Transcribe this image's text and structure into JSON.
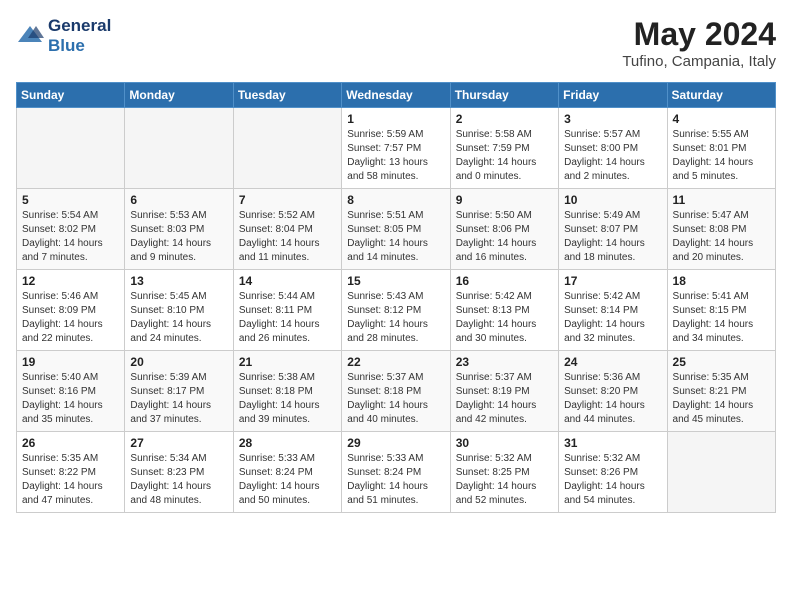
{
  "logo": {
    "line1": "General",
    "line2": "Blue"
  },
  "title": "May 2024",
  "location": "Tufino, Campania, Italy",
  "days_header": [
    "Sunday",
    "Monday",
    "Tuesday",
    "Wednesday",
    "Thursday",
    "Friday",
    "Saturday"
  ],
  "weeks": [
    [
      {
        "num": "",
        "info": ""
      },
      {
        "num": "",
        "info": ""
      },
      {
        "num": "",
        "info": ""
      },
      {
        "num": "1",
        "info": "Sunrise: 5:59 AM\nSunset: 7:57 PM\nDaylight: 13 hours\nand 58 minutes."
      },
      {
        "num": "2",
        "info": "Sunrise: 5:58 AM\nSunset: 7:59 PM\nDaylight: 14 hours\nand 0 minutes."
      },
      {
        "num": "3",
        "info": "Sunrise: 5:57 AM\nSunset: 8:00 PM\nDaylight: 14 hours\nand 2 minutes."
      },
      {
        "num": "4",
        "info": "Sunrise: 5:55 AM\nSunset: 8:01 PM\nDaylight: 14 hours\nand 5 minutes."
      }
    ],
    [
      {
        "num": "5",
        "info": "Sunrise: 5:54 AM\nSunset: 8:02 PM\nDaylight: 14 hours\nand 7 minutes."
      },
      {
        "num": "6",
        "info": "Sunrise: 5:53 AM\nSunset: 8:03 PM\nDaylight: 14 hours\nand 9 minutes."
      },
      {
        "num": "7",
        "info": "Sunrise: 5:52 AM\nSunset: 8:04 PM\nDaylight: 14 hours\nand 11 minutes."
      },
      {
        "num": "8",
        "info": "Sunrise: 5:51 AM\nSunset: 8:05 PM\nDaylight: 14 hours\nand 14 minutes."
      },
      {
        "num": "9",
        "info": "Sunrise: 5:50 AM\nSunset: 8:06 PM\nDaylight: 14 hours\nand 16 minutes."
      },
      {
        "num": "10",
        "info": "Sunrise: 5:49 AM\nSunset: 8:07 PM\nDaylight: 14 hours\nand 18 minutes."
      },
      {
        "num": "11",
        "info": "Sunrise: 5:47 AM\nSunset: 8:08 PM\nDaylight: 14 hours\nand 20 minutes."
      }
    ],
    [
      {
        "num": "12",
        "info": "Sunrise: 5:46 AM\nSunset: 8:09 PM\nDaylight: 14 hours\nand 22 minutes."
      },
      {
        "num": "13",
        "info": "Sunrise: 5:45 AM\nSunset: 8:10 PM\nDaylight: 14 hours\nand 24 minutes."
      },
      {
        "num": "14",
        "info": "Sunrise: 5:44 AM\nSunset: 8:11 PM\nDaylight: 14 hours\nand 26 minutes."
      },
      {
        "num": "15",
        "info": "Sunrise: 5:43 AM\nSunset: 8:12 PM\nDaylight: 14 hours\nand 28 minutes."
      },
      {
        "num": "16",
        "info": "Sunrise: 5:42 AM\nSunset: 8:13 PM\nDaylight: 14 hours\nand 30 minutes."
      },
      {
        "num": "17",
        "info": "Sunrise: 5:42 AM\nSunset: 8:14 PM\nDaylight: 14 hours\nand 32 minutes."
      },
      {
        "num": "18",
        "info": "Sunrise: 5:41 AM\nSunset: 8:15 PM\nDaylight: 14 hours\nand 34 minutes."
      }
    ],
    [
      {
        "num": "19",
        "info": "Sunrise: 5:40 AM\nSunset: 8:16 PM\nDaylight: 14 hours\nand 35 minutes."
      },
      {
        "num": "20",
        "info": "Sunrise: 5:39 AM\nSunset: 8:17 PM\nDaylight: 14 hours\nand 37 minutes."
      },
      {
        "num": "21",
        "info": "Sunrise: 5:38 AM\nSunset: 8:18 PM\nDaylight: 14 hours\nand 39 minutes."
      },
      {
        "num": "22",
        "info": "Sunrise: 5:37 AM\nSunset: 8:18 PM\nDaylight: 14 hours\nand 40 minutes."
      },
      {
        "num": "23",
        "info": "Sunrise: 5:37 AM\nSunset: 8:19 PM\nDaylight: 14 hours\nand 42 minutes."
      },
      {
        "num": "24",
        "info": "Sunrise: 5:36 AM\nSunset: 8:20 PM\nDaylight: 14 hours\nand 44 minutes."
      },
      {
        "num": "25",
        "info": "Sunrise: 5:35 AM\nSunset: 8:21 PM\nDaylight: 14 hours\nand 45 minutes."
      }
    ],
    [
      {
        "num": "26",
        "info": "Sunrise: 5:35 AM\nSunset: 8:22 PM\nDaylight: 14 hours\nand 47 minutes."
      },
      {
        "num": "27",
        "info": "Sunrise: 5:34 AM\nSunset: 8:23 PM\nDaylight: 14 hours\nand 48 minutes."
      },
      {
        "num": "28",
        "info": "Sunrise: 5:33 AM\nSunset: 8:24 PM\nDaylight: 14 hours\nand 50 minutes."
      },
      {
        "num": "29",
        "info": "Sunrise: 5:33 AM\nSunset: 8:24 PM\nDaylight: 14 hours\nand 51 minutes."
      },
      {
        "num": "30",
        "info": "Sunrise: 5:32 AM\nSunset: 8:25 PM\nDaylight: 14 hours\nand 52 minutes."
      },
      {
        "num": "31",
        "info": "Sunrise: 5:32 AM\nSunset: 8:26 PM\nDaylight: 14 hours\nand 54 minutes."
      },
      {
        "num": "",
        "info": ""
      }
    ]
  ]
}
